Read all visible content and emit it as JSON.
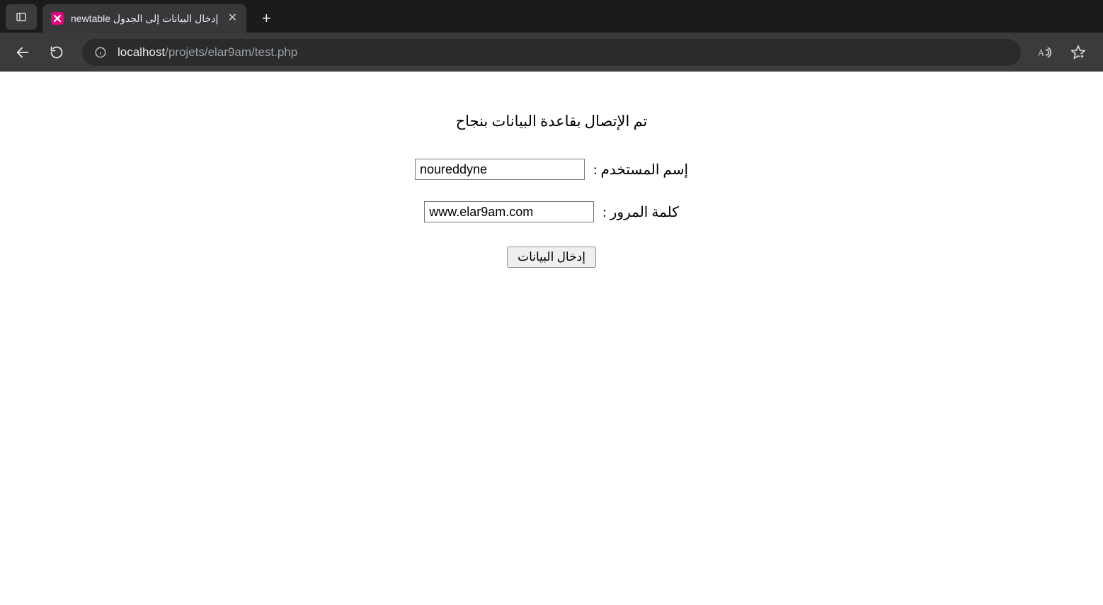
{
  "browser": {
    "tab_title": "إدخال البيانات إلى الجدول newtable",
    "url_host": "localhost",
    "url_path": "/projets/elar9am/test.php"
  },
  "page": {
    "status_message": "تم الإتصال بقاعدة البيانات بنجاح",
    "username_label": "إسم المستخدم :",
    "username_value": "noureddyne",
    "password_label": "كلمة المرور :",
    "password_value": "www.elar9am.com",
    "submit_label": "إدخال البيانات"
  }
}
